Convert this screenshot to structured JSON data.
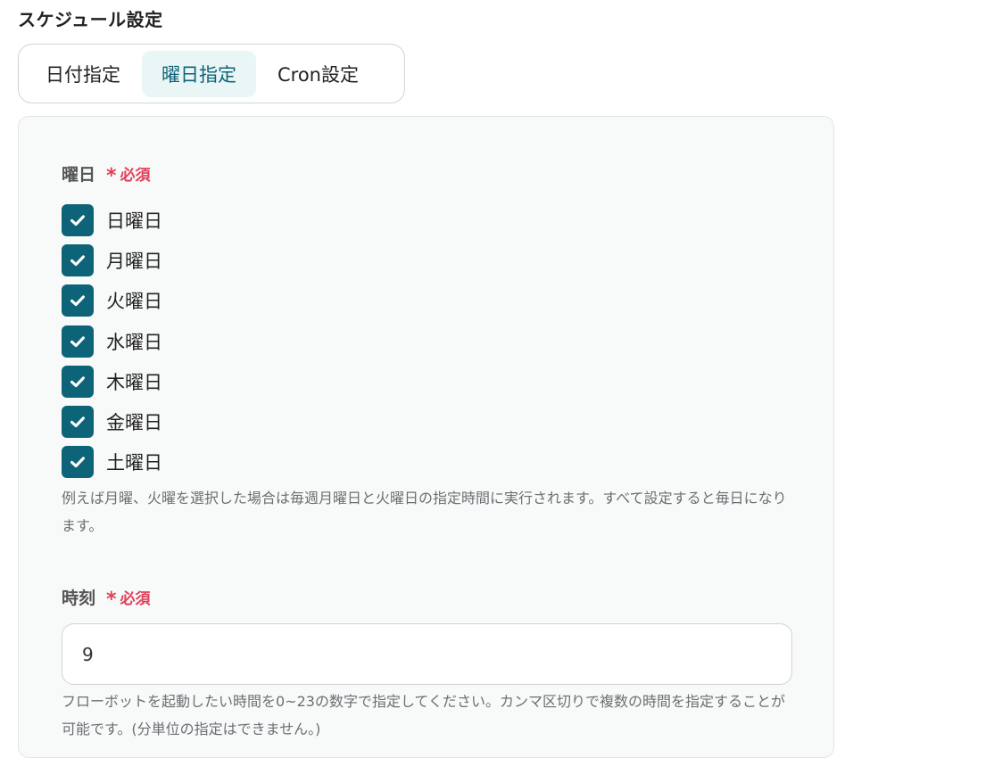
{
  "section_title": "スケジュール設定",
  "tabs": [
    {
      "label": "日付指定",
      "active": false
    },
    {
      "label": "曜日指定",
      "active": true
    },
    {
      "label": "Cron設定",
      "active": false
    }
  ],
  "weekday_field": {
    "label": "曜日",
    "required_mark": "*",
    "required_text": "必須",
    "days": [
      {
        "label": "日曜日",
        "checked": true
      },
      {
        "label": "月曜日",
        "checked": true
      },
      {
        "label": "火曜日",
        "checked": true
      },
      {
        "label": "水曜日",
        "checked": true
      },
      {
        "label": "木曜日",
        "checked": true
      },
      {
        "label": "金曜日",
        "checked": true
      },
      {
        "label": "土曜日",
        "checked": true
      }
    ],
    "help": "例えば月曜、火曜を選択した場合は毎週月曜日と火曜日の指定時間に実行されます。すべて設定すると毎日になります。"
  },
  "time_field": {
    "label": "時刻",
    "required_mark": "*",
    "required_text": "必須",
    "value": "9",
    "help": "フローボットを起動したい時間を0~23の数字で指定してください。カンマ区切りで複数の時間を指定することが可能です。(分単位の指定はできません。)"
  },
  "colors": {
    "accent": "#0d6377",
    "active_tab_bg": "#eaf5f5",
    "required": "#e0405a"
  }
}
